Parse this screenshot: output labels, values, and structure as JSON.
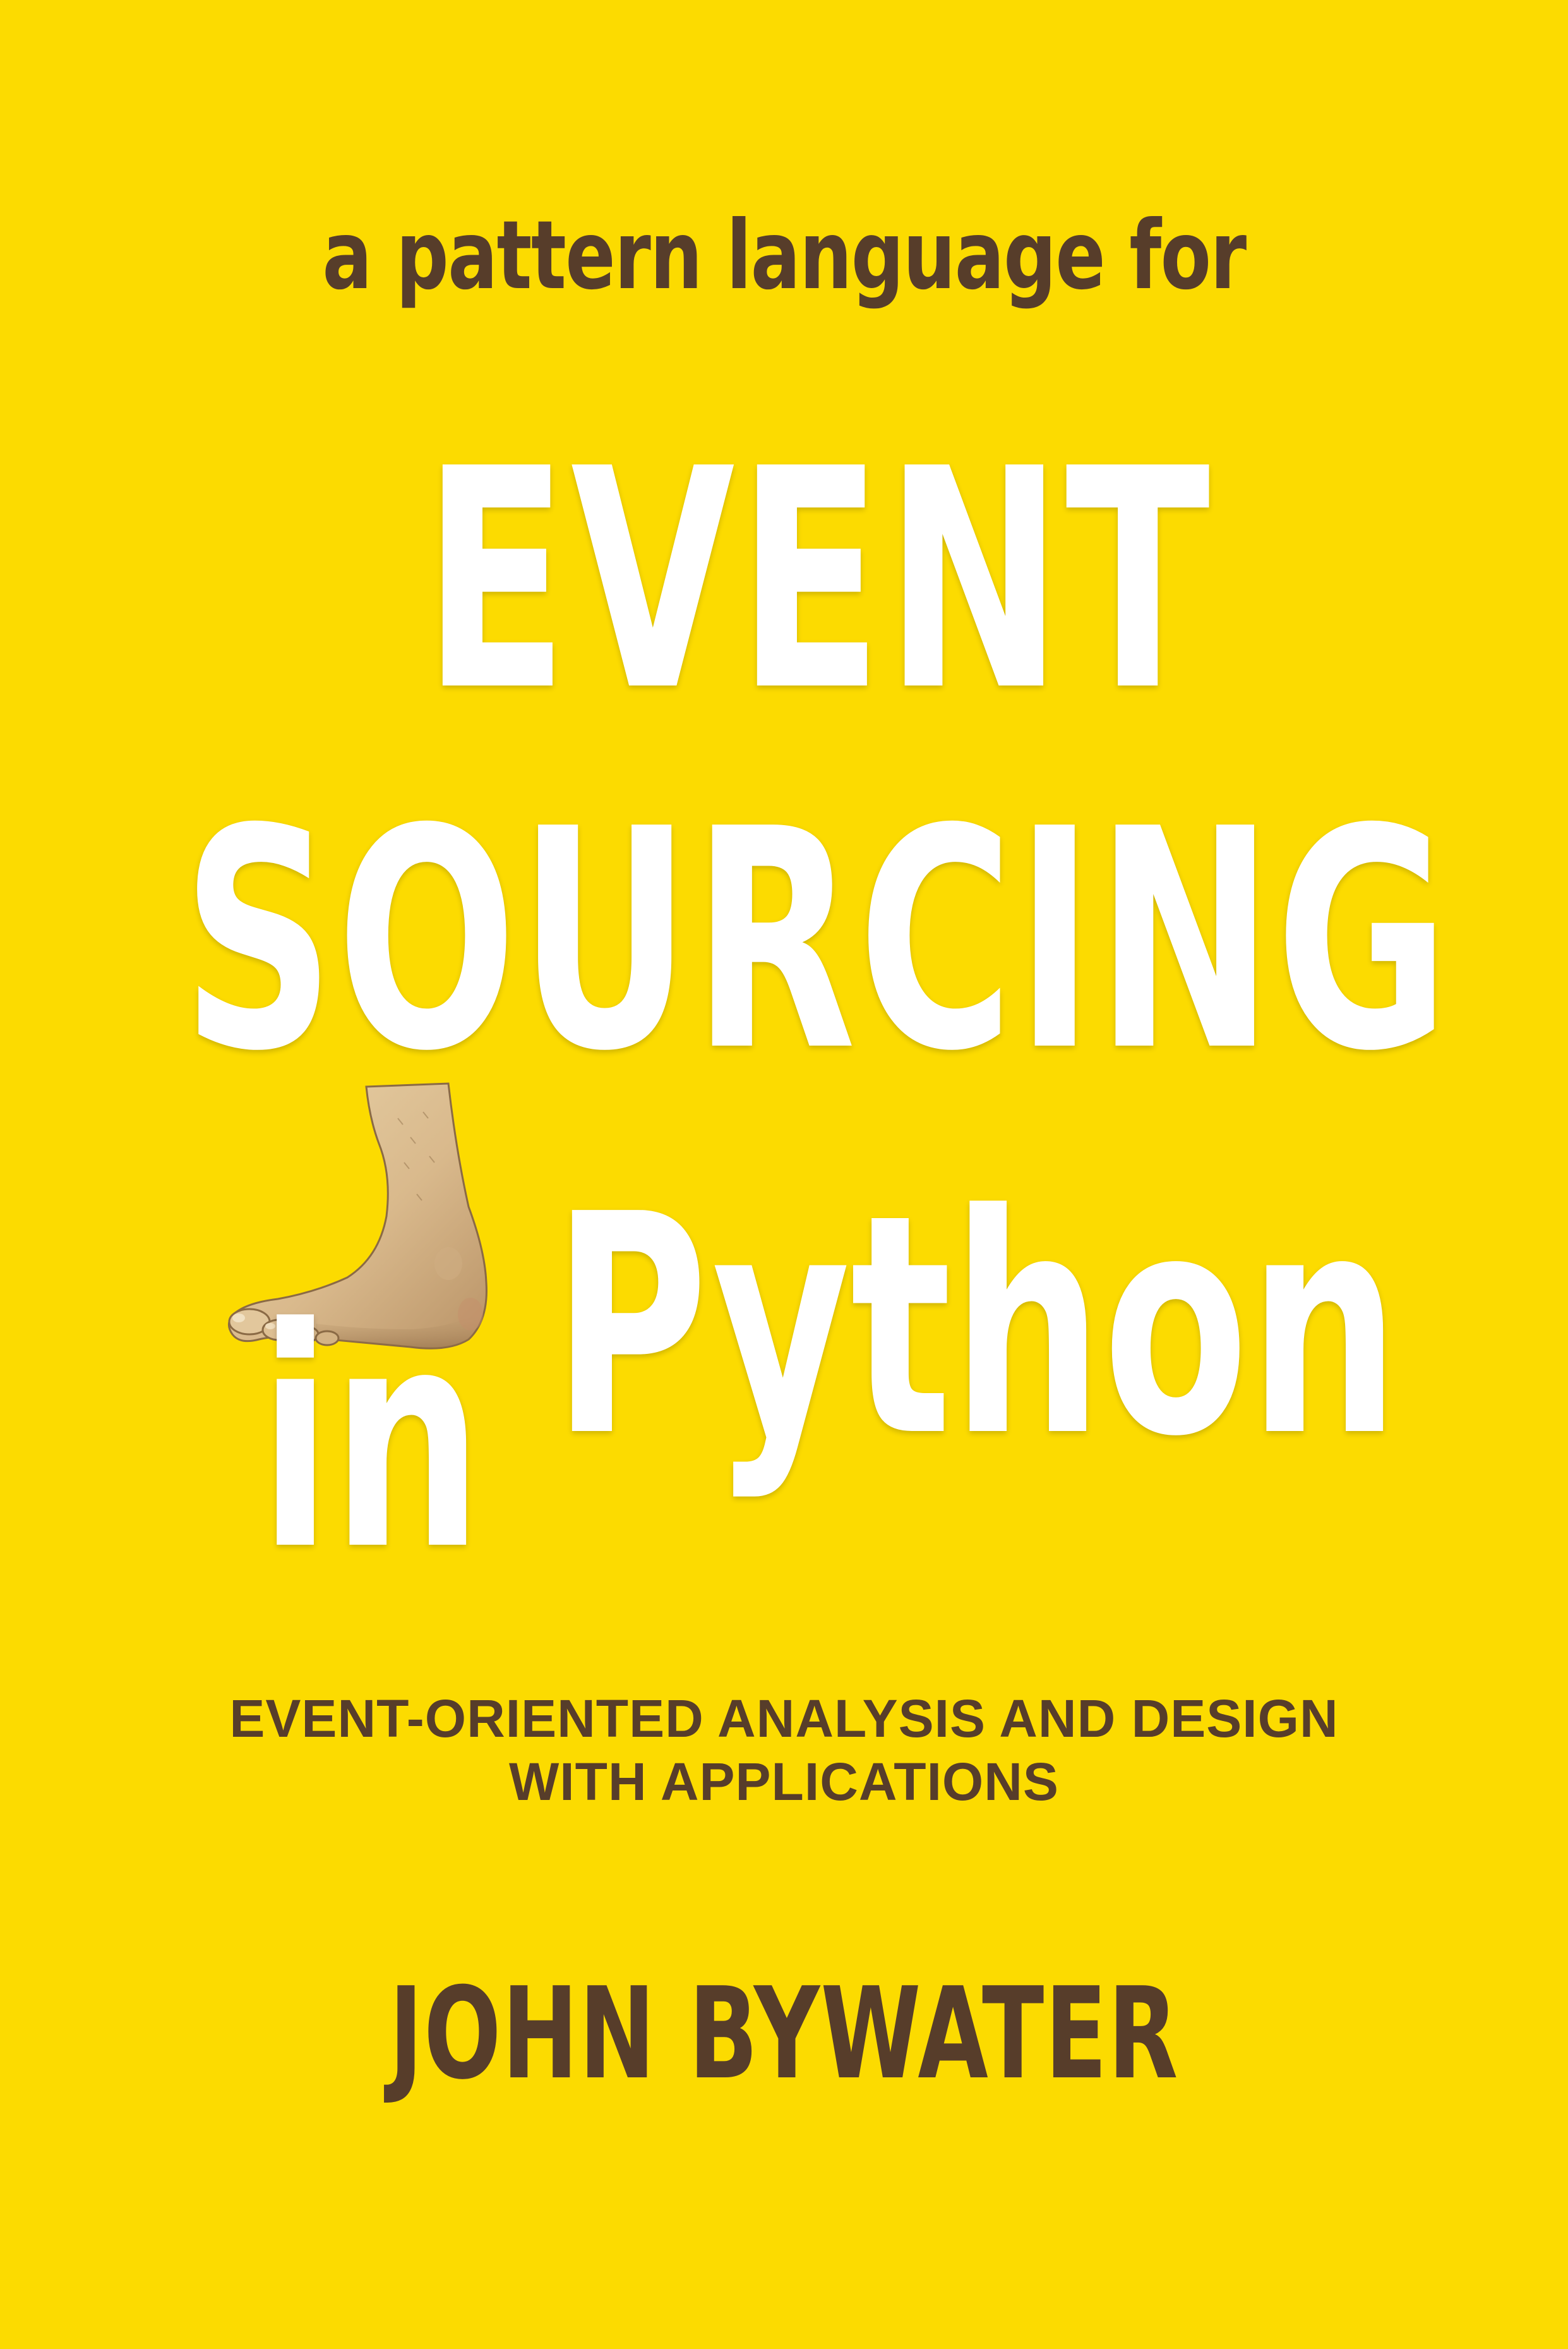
{
  "cover": {
    "background_color": "#fcdb00",
    "text_color_dark": "#573d2a",
    "text_color_light": "#ffffff",
    "tagline": "a pattern language for",
    "title": {
      "line1": "EVENT",
      "line2": "SOURCING",
      "line3_left": "in",
      "line3_right": "Python"
    },
    "subtitle": {
      "line1": "EVENT-ORIENTED ANALYSIS AND DESIGN",
      "line2": "WITH APPLICATIONS"
    },
    "author": "JOHN BYWATER",
    "illustration": "foot-illustration"
  }
}
